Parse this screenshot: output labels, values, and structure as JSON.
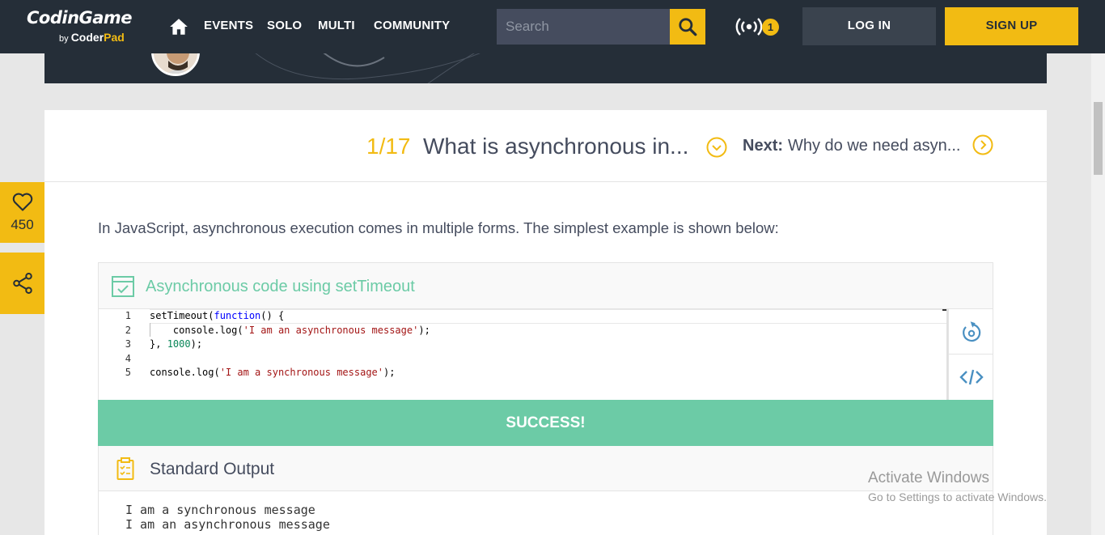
{
  "nav": {
    "brand": "CodinGame",
    "byline_prefix": "by",
    "byline_coder": "Coder",
    "byline_pad": "Pad",
    "links": [
      "EVENTS",
      "SOLO",
      "MULTI",
      "COMMUNITY"
    ],
    "search_placeholder": "Search",
    "notifications_count": "1",
    "login_label": "LOG IN",
    "signup_label": "SIGN UP"
  },
  "sidebar": {
    "likes_count": "450"
  },
  "step": {
    "number": "1/17",
    "title": "What is asynchronous in...",
    "next_label": "Next:",
    "next_title": "Why do we need asyn..."
  },
  "content": {
    "intro": "In JavaScript, asynchronous execution comes in multiple forms. The simplest example is shown below:"
  },
  "playground": {
    "title": "Asynchronous code using setTimeout",
    "code_lines": [
      {
        "num": "1",
        "text": "setTimeout(function() {"
      },
      {
        "num": "2",
        "text": "    console.log('I am an asynchronous message');"
      },
      {
        "num": "3",
        "text": "}, 1000);"
      },
      {
        "num": "4",
        "text": ""
      },
      {
        "num": "5",
        "text": "console.log('I am a synchronous message');"
      }
    ],
    "status": "SUCCESS!",
    "output_title": "Standard Output",
    "output_lines": [
      "I am a synchronous message",
      "I am an asynchronous message"
    ]
  },
  "watermark": {
    "title": "Activate Windows",
    "subtitle": "Go to Settings to activate Windows."
  },
  "colors": {
    "accent": "#f2bb13",
    "nav_bg": "#252e38",
    "success": "#6ccba6"
  }
}
